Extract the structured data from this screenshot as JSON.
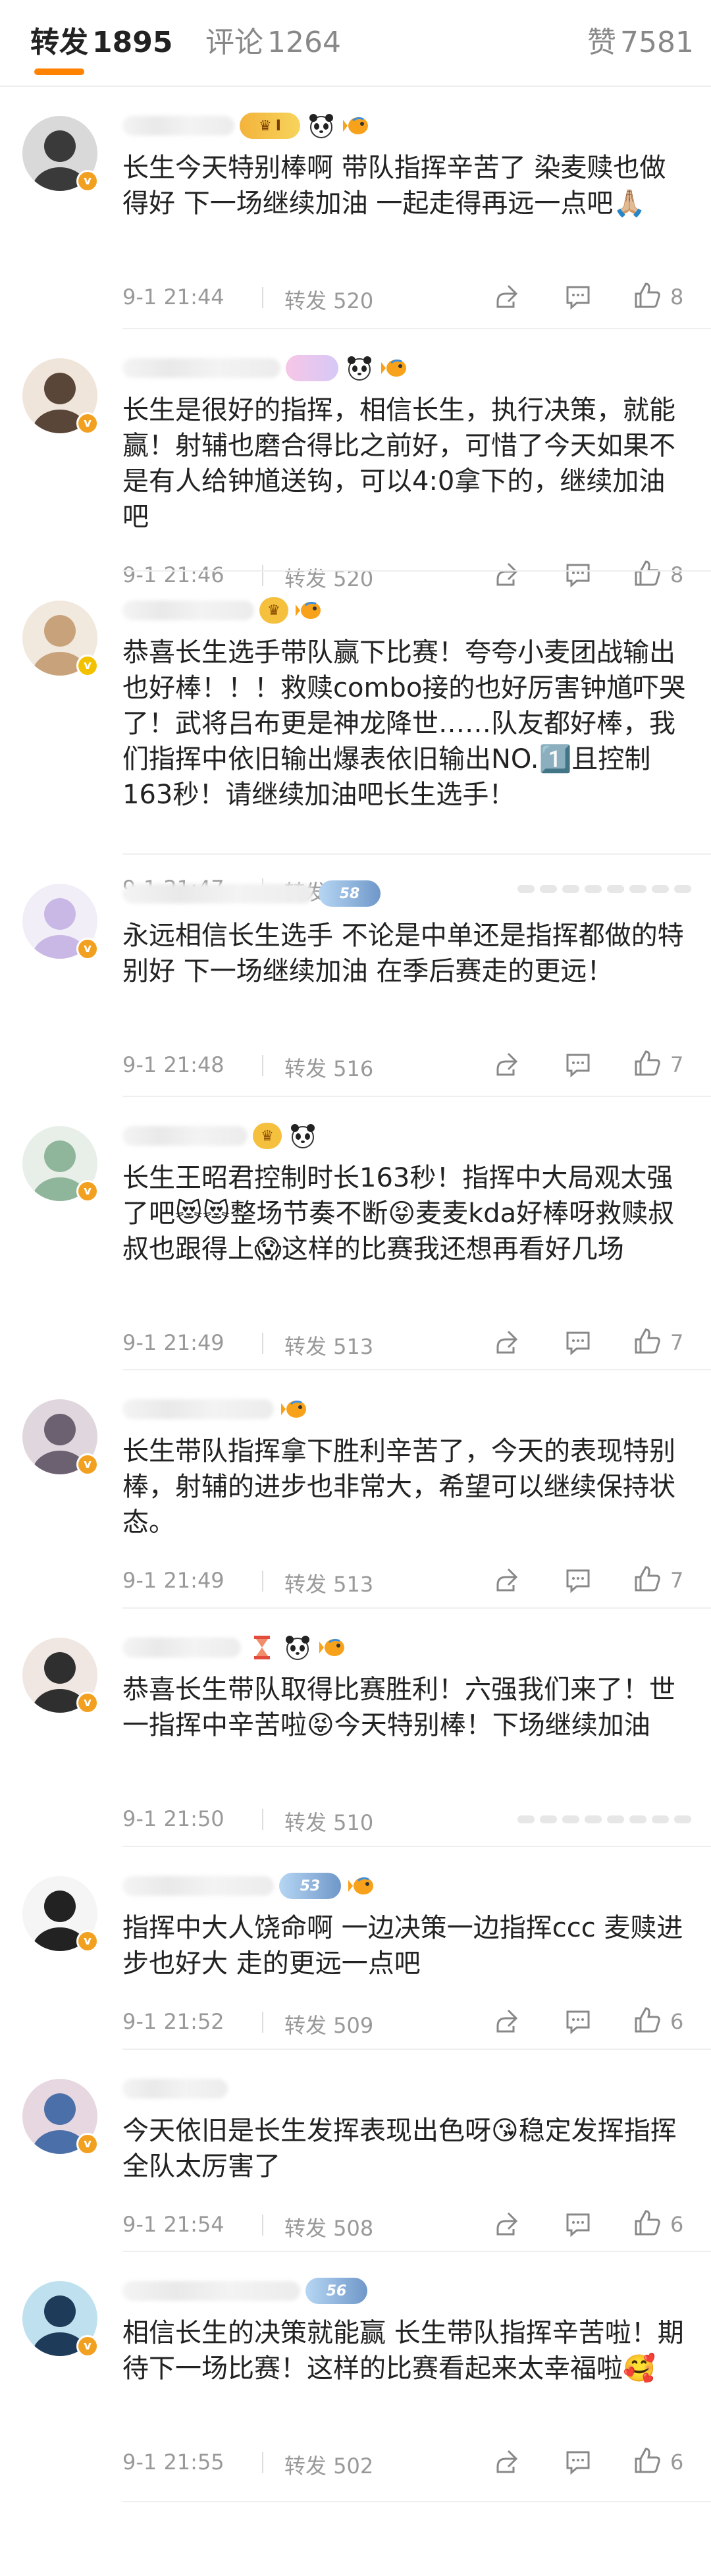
{
  "tabs": {
    "repost": {
      "label": "转发",
      "count": "1895"
    },
    "comment": {
      "label": "评论",
      "count": "1264"
    },
    "like": {
      "label": "赞",
      "count": "7581"
    }
  },
  "comments": [
    {
      "text": "长生今天特别棒啊 带队指挥辛苦了 染麦赎也做得好 下一场继续加油 一起走得再远一点吧🙏🏼",
      "time": "9-1 21:44",
      "repost": "转发 520",
      "likes": "8",
      "badges": [
        "crown-level-badge",
        "panda-icon",
        "fish-icon"
      ],
      "badge_text": "I"
    },
    {
      "text": "长生是很好的指挥，相信长生，执行决策，就能赢！射辅也磨合得比之前好，可惜了今天如果不是有人给钟馗送钩，可以4:0拿下的，继续加油吧",
      "time": "9-1 21:46",
      "repost": "转发 520",
      "likes": "8",
      "badges": [
        "pink-badge",
        "panda-icon",
        "fish-icon"
      ],
      "badge_text": ""
    },
    {
      "text": "恭喜长生选手带队赢下比赛！夸夸小麦团战输出也好棒！！！救赎combo接的也好厉害钟馗吓哭了！武将吕布更是神龙降世……队友都好棒，我们指挥中依旧输出爆表依旧输出NO.1️⃣且控制163秒！请继续加油吧长生选手！",
      "time": "9-1 21:47",
      "repost": "转发 518",
      "likes": "",
      "badges": [
        "crown-gold-badge",
        "fish-icon"
      ],
      "badge_text": ""
    },
    {
      "text": "永远相信长生选手 不论是中单还是指挥都做的特别好 下一场继续加油 在季后赛走的更远！",
      "time": "9-1 21:48",
      "repost": "转发 516",
      "likes": "7",
      "badges": [
        "level-58-badge"
      ],
      "badge_text": "58"
    },
    {
      "text": "长生王昭君控制时长163秒！指挥中大局观太强了吧😻😻整场节奏不断😝麦麦kda好棒呀救赎叔叔也跟得上😱这样的比赛我还想再看好几场",
      "time": "9-1 21:49",
      "repost": "转发 513",
      "likes": "7",
      "badges": [
        "crown-gold-badge",
        "panda-icon"
      ],
      "badge_text": ""
    },
    {
      "text": "长生带队指挥拿下胜利辛苦了，今天的表现特别棒，射辅的进步也非常大，希望可以继续保持状态。",
      "time": "9-1 21:49",
      "repost": "转发 513",
      "likes": "7",
      "badges": [
        "fish-icon"
      ],
      "badge_text": ""
    },
    {
      "text": "恭喜长生带队取得比赛胜利！六强我们来了！世一指挥中辛苦啦😝今天特别棒！下场继续加油",
      "time": "9-1 21:50",
      "repost": "转发 510",
      "likes": "",
      "badges": [
        "hourglass-icon",
        "panda-icon",
        "fish-icon"
      ],
      "badge_text": ""
    },
    {
      "text": "指挥中大人饶命啊 一边决策一边指挥ccc 麦赎进步也好大 走的更远一点吧",
      "time": "9-1 21:52",
      "repost": "转发 509",
      "likes": "6",
      "badges": [
        "level-53-badge",
        "fish-icon"
      ],
      "badge_text": "53"
    },
    {
      "text": "今天依旧是长生发挥表现出色呀😘稳定发挥指挥全队太厉害了",
      "time": "9-1 21:54",
      "repost": "转发 508",
      "likes": "6",
      "badges": [],
      "badge_text": ""
    },
    {
      "text": "相信长生的决策就能赢 长生带队指挥辛苦啦！期待下一场比赛！这样的比赛看起来太幸福啦🥰",
      "time": "9-1 21:55",
      "repost": "转发 502",
      "likes": "6",
      "badges": [
        "level-56-badge"
      ],
      "badge_text": "56"
    }
  ]
}
